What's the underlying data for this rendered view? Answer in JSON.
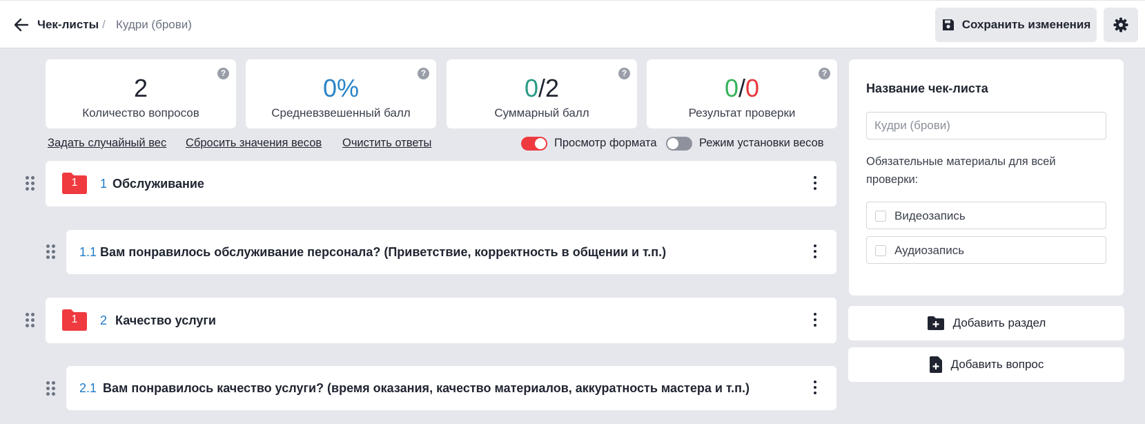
{
  "header": {
    "breadcrumb_root": "Чек-листы",
    "breadcrumb_separator": "/",
    "breadcrumb_current": "Кудри (брови)",
    "save_label": "Сохранить изменения"
  },
  "stats": [
    {
      "value": "2",
      "label": "Количество вопросов"
    },
    {
      "value": "0%",
      "label": "Средневзвешенный балл"
    },
    {
      "value_a": "0",
      "value_sep": "/",
      "value_b": "2",
      "label": "Суммарный балл"
    },
    {
      "value_a": "0",
      "value_sep": "/",
      "value_b": "0",
      "label": "Результат проверки"
    }
  ],
  "help_glyph": "?",
  "links": {
    "random_weight": "Задать случайный вес",
    "reset_weights": "Сбросить значения весов",
    "clear_answers": "Очистить ответы"
  },
  "toggles": {
    "format_preview": {
      "label": "Просмотр формата",
      "on": true
    },
    "weight_mode": {
      "label": "Режим установки весов",
      "on": false
    }
  },
  "sections": [
    {
      "badge": "1",
      "number": "1",
      "title": "Обслуживание",
      "question": {
        "number": "1.1",
        "title": "Вам понравилось обслуживание персонала? (Приветствие, корректность в общении и т.п.)"
      }
    },
    {
      "badge": "1",
      "number": "2",
      "title": "Качество услуги",
      "question": {
        "number": "2.1",
        "title": "Вам понравилось качество услуги? (время оказания, качество материалов, аккуратность мастера и т.п.)"
      }
    }
  ],
  "panel": {
    "title": "Название чек-листа",
    "name_placeholder": "Кудри (брови)",
    "materials_note": "Обязательные материалы для всей проверки:",
    "video_label": "Видеозапись",
    "audio_label": "Аудиозапись"
  },
  "actions": {
    "add_section": "Добавить раздел",
    "add_question": "Добавить вопрос"
  },
  "colors": {
    "accent_blue": "#2a83c7",
    "teal": "#2b9a84",
    "green": "#36b35a",
    "red": "#e8363c",
    "toggle_on": "#ee3a3f",
    "toggle_off": "#8e929c"
  },
  "icons": [
    "back-arrow-icon",
    "save-disk-icon",
    "gear-icon",
    "help-icon",
    "drag-handle-icon",
    "folder-icon",
    "kebab-menu-icon",
    "folder-plus-icon",
    "file-plus-icon"
  ]
}
